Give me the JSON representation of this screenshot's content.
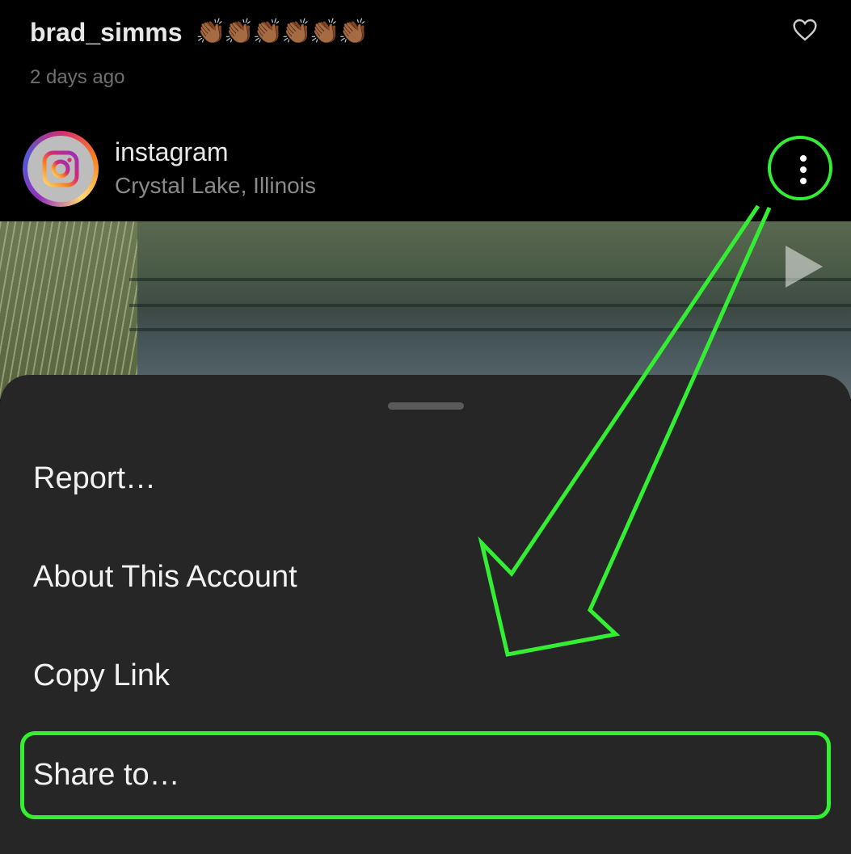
{
  "comment": {
    "username": "brad_simms",
    "emoji": "👏🏾👏🏾👏🏾👏🏾👏🏾👏🏾",
    "timestamp": "2 days ago"
  },
  "post": {
    "account": "instagram",
    "location": "Crystal Lake, Illinois"
  },
  "menu": {
    "items": [
      {
        "label": "Report…"
      },
      {
        "label": "About This Account"
      },
      {
        "label": "Copy Link"
      },
      {
        "label": "Share to…"
      }
    ]
  },
  "colors": {
    "highlight": "#33ee33",
    "sheet": "#262626",
    "background": "#000000"
  },
  "icons": [
    "heart-icon",
    "instagram-logo-icon",
    "more-vertical-icon",
    "play-icon"
  ]
}
